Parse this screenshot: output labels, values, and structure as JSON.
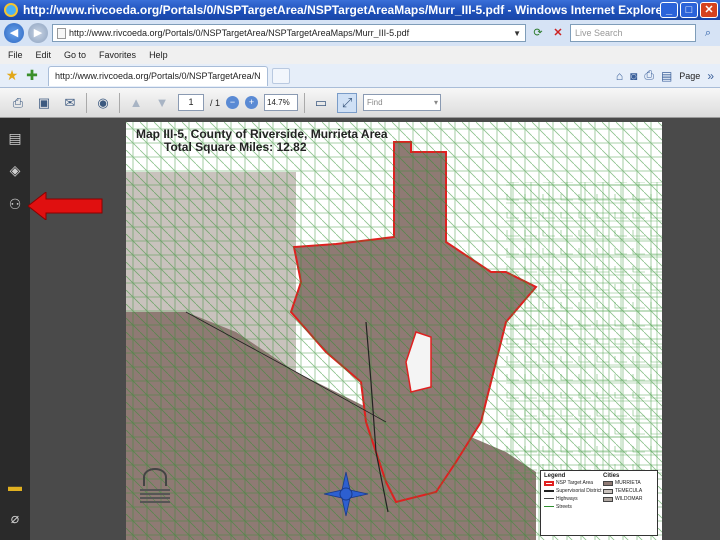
{
  "window": {
    "title": "http://www.rivcoeda.org/Portals/0/NSPTargetArea/NSPTargetAreaMaps/Murr_III-5.pdf - Windows Internet Explorer",
    "minimize": "_",
    "maximize": "□",
    "close": "✕"
  },
  "address": {
    "url": "http://www.rivcoeda.org/Portals/0/NSPTargetArea/NSPTargetAreaMaps/Murr_III-5.pdf",
    "search_placeholder": "Live Search"
  },
  "menu": [
    "File",
    "Edit",
    "Go to",
    "Favorites",
    "Help"
  ],
  "tabs": {
    "active_tab": "http://www.rivcoeda.org/Portals/0/NSPTargetArea/N",
    "commands": [
      "Page"
    ]
  },
  "pdf_toolbar": {
    "current_page": "1",
    "total_pages": "/ 1",
    "zoom": "14.7%",
    "find_placeholder": "Find"
  },
  "map": {
    "title_line1": "Map III-5, County of Riverside, Murrieta Area",
    "title_line2": "Total Square Miles: 12.82",
    "legend": {
      "title": "Legend",
      "col1": [
        "NSP Target Area",
        "Supervisorial District",
        "Highways",
        "Streets"
      ],
      "col2_title": "Cities",
      "col2": [
        "MURRIETA",
        "TEMECULA",
        "WILDOMAR"
      ]
    }
  },
  "colors": {
    "target_area": "#8f7a74",
    "outline": "#e02020",
    "streets": "#2f8f2f",
    "arrow": "#e01010"
  }
}
